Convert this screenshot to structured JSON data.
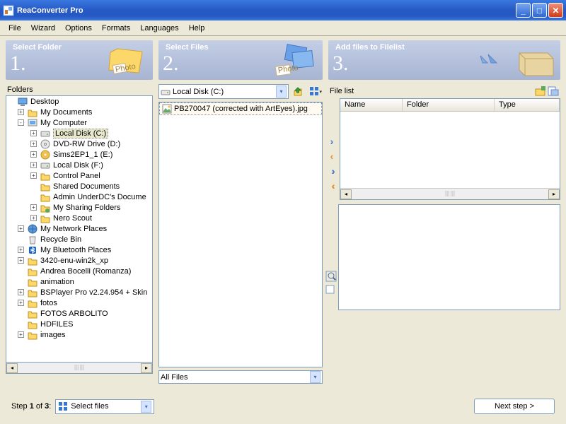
{
  "window": {
    "title": "ReaConverter Pro"
  },
  "menu": [
    "File",
    "Wizard",
    "Options",
    "Formats",
    "Languages",
    "Help"
  ],
  "banner1": {
    "num": "1.",
    "label": "Select Folder"
  },
  "banner2": {
    "num": "2.",
    "label": "Select Files"
  },
  "banner3": {
    "num": "3.",
    "label": "Add files to Filelist"
  },
  "label_folders": "Folders",
  "tree": [
    {
      "pad": 2,
      "tog": "",
      "ico": "desktop",
      "txt": "Desktop"
    },
    {
      "pad": 16,
      "tog": "+",
      "ico": "folder",
      "txt": "My Documents"
    },
    {
      "pad": 16,
      "tog": "-",
      "ico": "computer",
      "txt": "My Computer"
    },
    {
      "pad": 34,
      "tog": "+",
      "ico": "drive",
      "txt": "Local Disk (C:)",
      "sel": true
    },
    {
      "pad": 34,
      "tog": "+",
      "ico": "cd",
      "txt": "DVD-RW Drive (D:)"
    },
    {
      "pad": 34,
      "tog": "+",
      "ico": "cdicon",
      "txt": "Sims2EP1_1 (E:)"
    },
    {
      "pad": 34,
      "tog": "+",
      "ico": "drive",
      "txt": "Local Disk (F:)"
    },
    {
      "pad": 34,
      "tog": "+",
      "ico": "folder",
      "txt": "Control Panel"
    },
    {
      "pad": 34,
      "tog": "",
      "ico": "folder",
      "txt": "Shared Documents"
    },
    {
      "pad": 34,
      "tog": "",
      "ico": "folder",
      "txt": "Admin UnderDC's Docume"
    },
    {
      "pad": 34,
      "tog": "+",
      "ico": "share",
      "txt": "My Sharing Folders"
    },
    {
      "pad": 34,
      "tog": "+",
      "ico": "folder",
      "txt": "Nero Scout"
    },
    {
      "pad": 16,
      "tog": "+",
      "ico": "network",
      "txt": "My Network Places"
    },
    {
      "pad": 16,
      "tog": "",
      "ico": "recycle",
      "txt": "Recycle Bin"
    },
    {
      "pad": 16,
      "tog": "+",
      "ico": "bt",
      "txt": "My Bluetooth Places"
    },
    {
      "pad": 16,
      "tog": "+",
      "ico": "folder",
      "txt": "3420-enu-win2k_xp"
    },
    {
      "pad": 16,
      "tog": "",
      "ico": "folder",
      "txt": "Andrea Bocelli (Romanza)"
    },
    {
      "pad": 16,
      "tog": "",
      "ico": "folder",
      "txt": "animation"
    },
    {
      "pad": 16,
      "tog": "+",
      "ico": "folder",
      "txt": "BSPlayer Pro v2.24.954 + Skin"
    },
    {
      "pad": 16,
      "tog": "+",
      "ico": "folder",
      "txt": "fotos"
    },
    {
      "pad": 16,
      "tog": "",
      "ico": "folder",
      "txt": "FOTOS ARBOLITO"
    },
    {
      "pad": 16,
      "tog": "",
      "ico": "folder",
      "txt": "HDFILES"
    },
    {
      "pad": 16,
      "tog": "+",
      "ico": "folder",
      "txt": "images"
    }
  ],
  "drive_combo": "Local Disk (C:)",
  "files": [
    {
      "name": "PB270047 (corrected with ArtEyes).jpg",
      "sel": true
    }
  ],
  "filter": "All Files",
  "filelist_label": "File list",
  "columns": {
    "name": "Name",
    "folder": "Folder",
    "type": "Type"
  },
  "step_label_pre": "Step ",
  "step_bold": "1",
  "step_label_mid": " of ",
  "step_total": "3",
  "step_label_post": ":",
  "step_combo": "Select files",
  "next": "Next step >"
}
